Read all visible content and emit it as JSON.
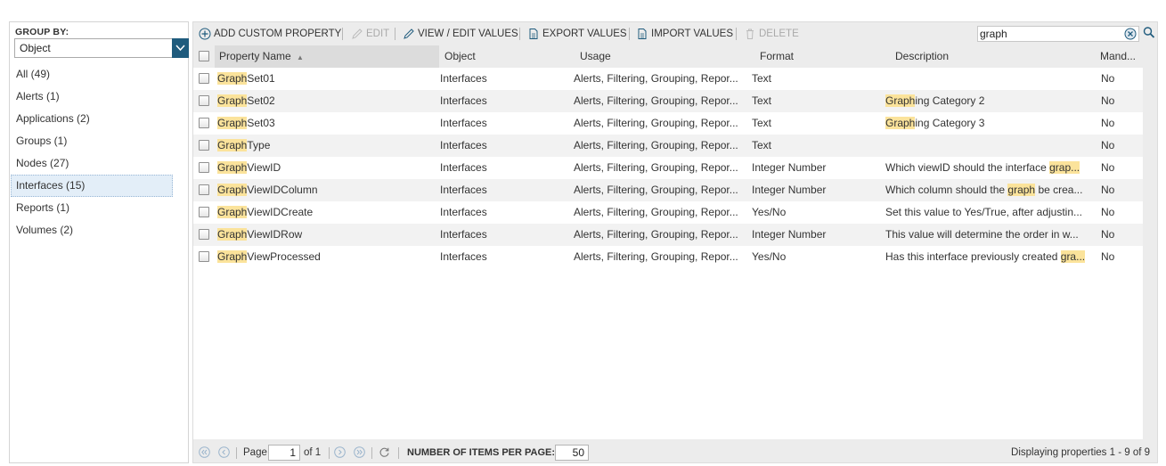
{
  "sidebar": {
    "group_by_label": "GROUP BY:",
    "group_by_value": "Object",
    "items": [
      {
        "label": "All (49)",
        "selected": false
      },
      {
        "label": "Alerts (1)",
        "selected": false
      },
      {
        "label": "Applications (2)",
        "selected": false
      },
      {
        "label": "Groups (1)",
        "selected": false
      },
      {
        "label": "Nodes (27)",
        "selected": false
      },
      {
        "label": "Interfaces (15)",
        "selected": true
      },
      {
        "label": "Reports (1)",
        "selected": false
      },
      {
        "label": "Volumes (2)",
        "selected": false
      }
    ]
  },
  "toolbar": {
    "add_label": "ADD CUSTOM PROPERTY",
    "edit_label": "EDIT",
    "view_edit_label": "VIEW / EDIT VALUES",
    "export_label": "EXPORT VALUES",
    "import_label": "IMPORT VALUES",
    "delete_label": "DELETE"
  },
  "search": {
    "value": "graph",
    "highlight": "Graph"
  },
  "grid": {
    "columns": {
      "name": "Property Name",
      "object": "Object",
      "usage": "Usage",
      "format": "Format",
      "description": "Description",
      "mandatory": "Mand..."
    },
    "rows": [
      {
        "name_hl": "Graph",
        "name_rest": "Set01",
        "object": "Interfaces",
        "usage": "Alerts, Filtering, Grouping, Repor...",
        "format": "Text",
        "desc_pre": "",
        "desc_hl": "",
        "desc_post": "",
        "mandatory": "No"
      },
      {
        "name_hl": "Graph",
        "name_rest": "Set02",
        "object": "Interfaces",
        "usage": "Alerts, Filtering, Grouping, Repor...",
        "format": "Text",
        "desc_pre": "",
        "desc_hl": "Graph",
        "desc_post": "ing Category 2",
        "mandatory": "No"
      },
      {
        "name_hl": "Graph",
        "name_rest": "Set03",
        "object": "Interfaces",
        "usage": "Alerts, Filtering, Grouping, Repor...",
        "format": "Text",
        "desc_pre": "",
        "desc_hl": "Graph",
        "desc_post": "ing Category 3",
        "mandatory": "No"
      },
      {
        "name_hl": "Graph",
        "name_rest": "Type",
        "object": "Interfaces",
        "usage": "Alerts, Filtering, Grouping, Repor...",
        "format": "Text",
        "desc_pre": "",
        "desc_hl": "",
        "desc_post": "",
        "mandatory": "No"
      },
      {
        "name_hl": "Graph",
        "name_rest": "ViewID",
        "object": "Interfaces",
        "usage": "Alerts, Filtering, Grouping, Repor...",
        "format": "Integer Number",
        "desc_pre": "Which viewID should the interface ",
        "desc_hl": "grap...",
        "desc_post": "",
        "mandatory": "No"
      },
      {
        "name_hl": "Graph",
        "name_rest": "ViewIDColumn",
        "object": "Interfaces",
        "usage": "Alerts, Filtering, Grouping, Repor...",
        "format": "Integer Number",
        "desc_pre": "Which column should the ",
        "desc_hl": "graph",
        "desc_post": " be crea...",
        "mandatory": "No"
      },
      {
        "name_hl": "Graph",
        "name_rest": "ViewIDCreate",
        "object": "Interfaces",
        "usage": "Alerts, Filtering, Grouping, Repor...",
        "format": "Yes/No",
        "desc_pre": "Set this value to Yes/True, after adjustin...",
        "desc_hl": "",
        "desc_post": "",
        "mandatory": "No"
      },
      {
        "name_hl": "Graph",
        "name_rest": "ViewIDRow",
        "object": "Interfaces",
        "usage": "Alerts, Filtering, Grouping, Repor...",
        "format": "Integer Number",
        "desc_pre": "This value will determine the order in w...",
        "desc_hl": "",
        "desc_post": "",
        "mandatory": "No"
      },
      {
        "name_hl": "Graph",
        "name_rest": "ViewProcessed",
        "object": "Interfaces",
        "usage": "Alerts, Filtering, Grouping, Repor...",
        "format": "Yes/No",
        "desc_pre": "Has this interface previously created ",
        "desc_hl": "gra...",
        "desc_post": "",
        "mandatory": "No"
      }
    ]
  },
  "pager": {
    "page_label": "Page",
    "page_value": "1",
    "of_label": "of 1",
    "items_per_page_label": "NUMBER OF ITEMS PER PAGE:",
    "items_per_page_value": "50",
    "summary": "Displaying properties 1 - 9 of 9"
  },
  "colors": {
    "accent": "#1f5b7d",
    "highlight": "#fbe39b",
    "selected_bg": "#e3eef8"
  }
}
